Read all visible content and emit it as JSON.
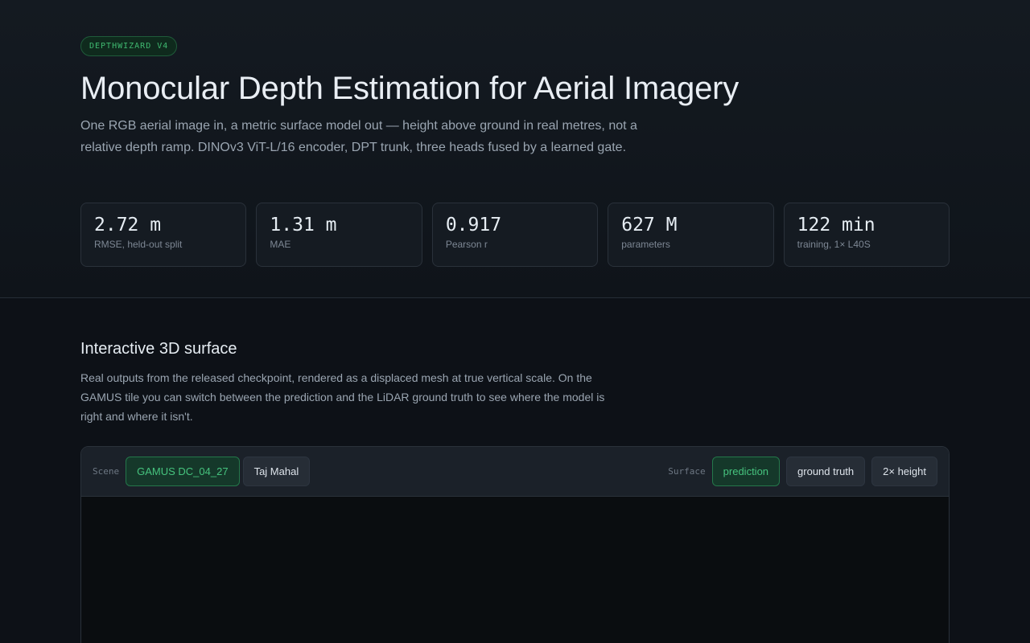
{
  "hero": {
    "badge": "DEPTHWIZARD V4",
    "title": "Monocular Depth Estimation for Aerial Imagery",
    "subtitle": "One RGB aerial image in, a metric surface model out — height above ground in real metres, not a relative depth ramp. DINOv3 ViT-L/16 encoder, DPT trunk, three heads fused by a learned gate.",
    "stats": [
      {
        "value": "2.72 m",
        "label": "RMSE, held-out split"
      },
      {
        "value": "1.31 m",
        "label": "MAE"
      },
      {
        "value": "0.917",
        "label": "Pearson r"
      },
      {
        "value": "627 M",
        "label": "parameters"
      },
      {
        "value": "122 min",
        "label": "training, 1× L40S"
      }
    ]
  },
  "section": {
    "title": "Interactive 3D surface",
    "description": "Real outputs from the released checkpoint, rendered as a displaced mesh at true vertical scale. On the GAMUS tile you can switch between the prediction and the LiDAR ground truth to see where the model is right and where it isn't."
  },
  "viewer": {
    "scene_label": "Scene",
    "scenes": [
      {
        "label": "GAMUS DC_04_27",
        "active": true
      },
      {
        "label": "Taj Mahal",
        "active": false
      }
    ],
    "surface_label": "Surface",
    "surfaces": [
      {
        "label": "prediction",
        "active": true
      },
      {
        "label": "ground truth",
        "active": false
      },
      {
        "label": "2× height",
        "active": false
      }
    ]
  },
  "colors": {
    "background": "#0d1117",
    "accent": "#46c37e",
    "accent_bg": "#15382a"
  }
}
